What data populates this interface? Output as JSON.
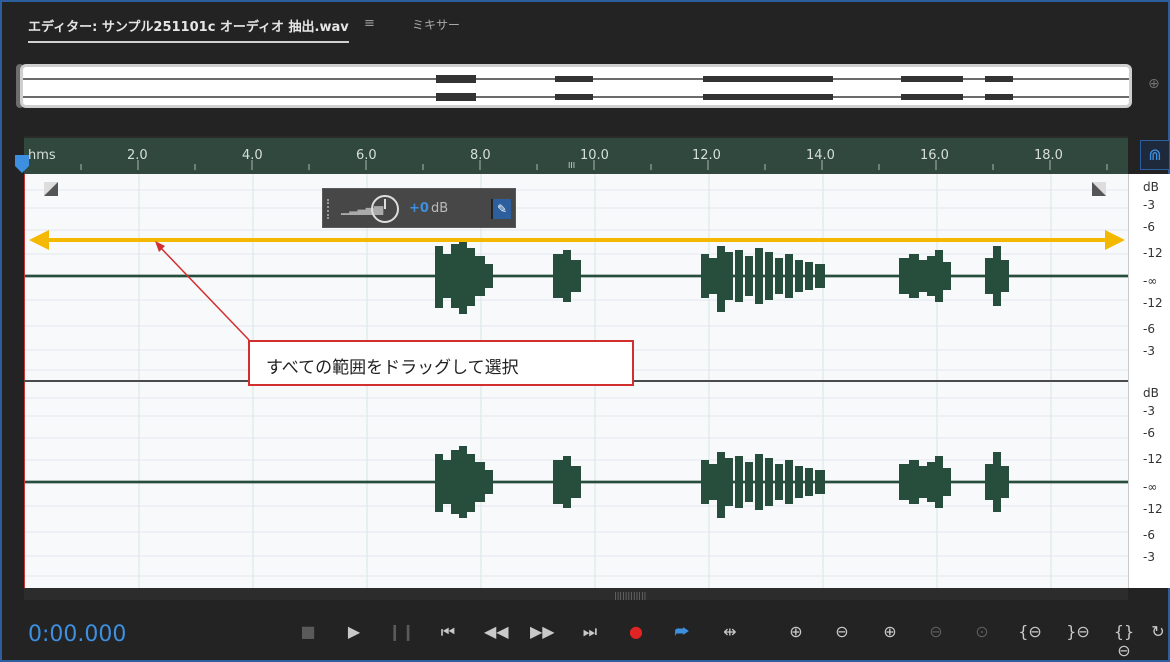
{
  "tabs": {
    "editor_label": "エディター: サンプル251101c オーディオ 抽出.wav",
    "menu_icon": "≡",
    "mixer_label": "ミキサー"
  },
  "ruler": {
    "labels": [
      "hms",
      "2.0",
      "4.0",
      "6.0",
      "8.0",
      "10.0",
      "12.0",
      "14.0",
      "16.0",
      "18.0"
    ]
  },
  "db_scale": {
    "top": [
      "dB",
      "-3",
      "-6",
      "-12",
      "-∞",
      "-12",
      "-6",
      "-3"
    ],
    "bottom": [
      "dB",
      "-3",
      "-6",
      "-12",
      "-∞",
      "-12",
      "-6",
      "-3"
    ]
  },
  "hud": {
    "value": "+0",
    "unit": "dB"
  },
  "callout": {
    "text": "すべての範囲をドラッグして選択"
  },
  "transport": {
    "timecode": "0:00.000"
  },
  "colors": {
    "accent": "#3d8fe0",
    "waveform": "#274d3c",
    "selection_arrow": "#f5b800",
    "callout_border": "#d32f2f",
    "record": "#e02424"
  },
  "icons": [
    "stop-icon",
    "play-icon",
    "pause-icon",
    "skip-start-icon",
    "rewind-icon",
    "fast-forward-icon",
    "skip-end-icon",
    "record-icon",
    "loop-icon",
    "skip-selection-icon",
    "zoom-in-amplitude-icon",
    "zoom-out-amplitude-icon",
    "zoom-in-time-icon",
    "zoom-out-time-icon",
    "zoom-out-full-icon",
    "zoom-in-left-icon",
    "zoom-in-right-icon",
    "zoom-selection-icon",
    "reset-zoom-icon",
    "snap-icon",
    "pin-icon"
  ]
}
